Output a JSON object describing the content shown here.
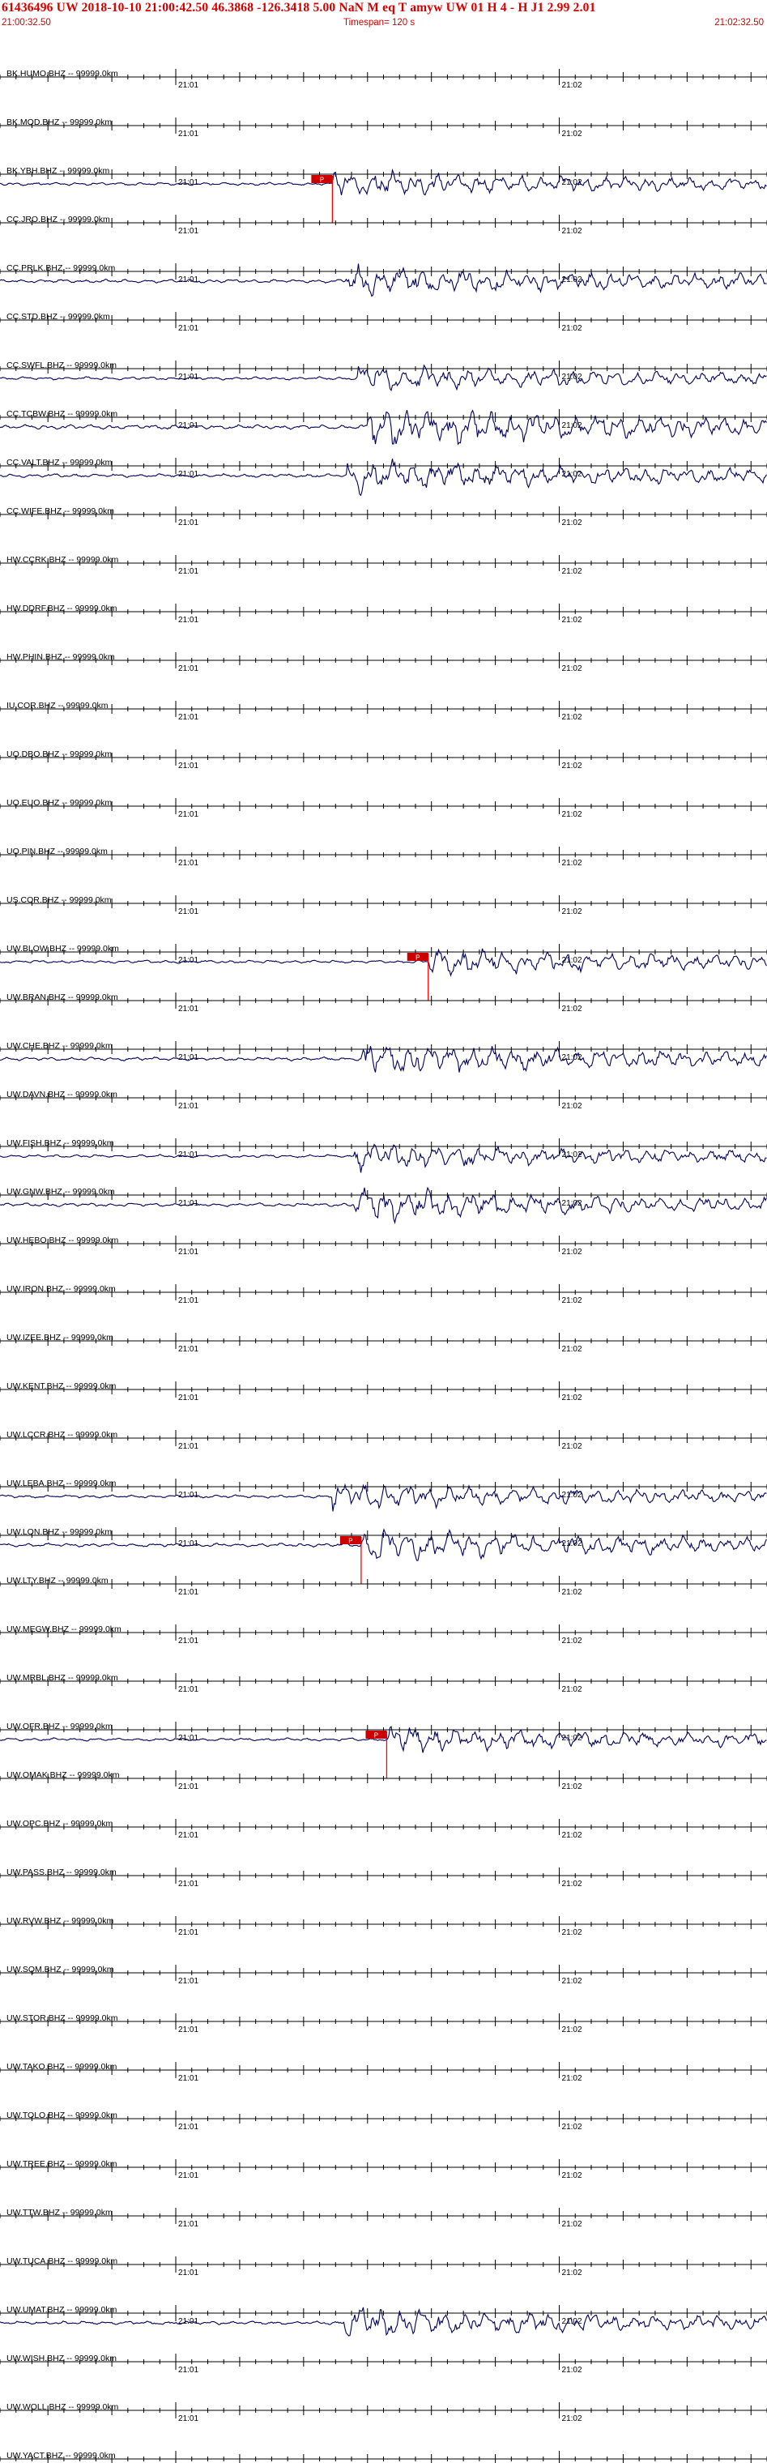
{
  "header": {
    "title": "61436496 UW 2018-10-10 21:00:42.50   46.3868 -126.3418   5.00   NaN M   eq  T amyw     UW 01  H   4  -   H J1    2.99  2.01",
    "start_time": "21:00:32.50",
    "timespan": "Timespan= 120 s",
    "end_time": "21:02:32.50"
  },
  "chart_data": {
    "type": "line",
    "title": "61436496 UW 2018-10-10 21:00:42.50",
    "x_axis": {
      "unit": "s",
      "range": [
        0,
        120
      ],
      "tick_labels": [
        {
          "label": "21:01",
          "t": 27.5
        },
        {
          "label": "21:02",
          "t": 87.5
        }
      ],
      "minor_tick_interval": 2.5
    },
    "colors": {
      "trace": "#00005a",
      "axis": "#000000",
      "pick": "#ff0000",
      "header_text": "#d40000"
    },
    "pick_label": "P",
    "traces": [
      {
        "label": "BK.HUMO.BHZ -- 99999.0km",
        "amp": 0,
        "pick": null
      },
      {
        "label": "BK.MOD.BHZ -- 99999.0km",
        "amp": 0,
        "pick": null
      },
      {
        "label": "BK.YBH.BHZ -- 99999.0km",
        "amp": 12,
        "pick": 52
      },
      {
        "label": "CC.JRO.BHZ -- 99999.0km",
        "amp": 0,
        "pick": null
      },
      {
        "label": "CC.PRLK.BHZ -- 99999.0km",
        "amp": 14,
        "pick": null
      },
      {
        "label": "CC.STD.BHZ -- 99999.0km",
        "amp": 0,
        "pick": null
      },
      {
        "label": "CC.SWFL.BHZ -- 99999.0km",
        "amp": 12,
        "pick": null
      },
      {
        "label": "CC.TCBW.BHZ -- 99999.0km",
        "amp": 18,
        "pick": null
      },
      {
        "label": "CC.VALT.BHZ -- 99999.0km",
        "amp": 14,
        "pick": null
      },
      {
        "label": "CC.WIFE.BHZ -- 99999.0km",
        "amp": 0,
        "pick": null
      },
      {
        "label": "HW.CCRK.BHZ -- 99999.0km",
        "amp": 0,
        "pick": null
      },
      {
        "label": "HW.DDRF.BHZ -- 99999.0km",
        "amp": 0,
        "pick": null
      },
      {
        "label": "HW.PHIN.BHZ -- 99999.0km",
        "amp": 0,
        "pick": null
      },
      {
        "label": "IU.COR.BHZ -- 99999.0km",
        "amp": 0,
        "pick": null
      },
      {
        "label": "UO.DBO.BHZ -- 99999.0km",
        "amp": 0,
        "pick": null
      },
      {
        "label": "UO.EUO.BHZ -- 99999.0km",
        "amp": 0,
        "pick": null
      },
      {
        "label": "UO.PIN.BHZ -- 99999.0km",
        "amp": 0,
        "pick": null
      },
      {
        "label": "US.COR.BHZ -- 99999.0km",
        "amp": 0,
        "pick": null
      },
      {
        "label": "UW.BLOW.BHZ -- 99999.0km",
        "amp": 12,
        "pick": 67
      },
      {
        "label": "UW.BRAN.BHZ -- 99999.0km",
        "amp": 0,
        "pick": null
      },
      {
        "label": "UW.CHE.BHZ -- 99999.0km",
        "amp": 14,
        "pick": null
      },
      {
        "label": "UW.DAVN.BHZ -- 99999.0km",
        "amp": 0,
        "pick": null
      },
      {
        "label": "UW.FISH.BHZ -- 99999.0km",
        "amp": 12,
        "pick": null
      },
      {
        "label": "UW.GNW.BHZ -- 99999.0km",
        "amp": 14,
        "pick": null
      },
      {
        "label": "UW.HEBO.BHZ -- 99999.0km",
        "amp": 0,
        "pick": null
      },
      {
        "label": "UW.IRON.BHZ -- 99999.0km",
        "amp": 0,
        "pick": null
      },
      {
        "label": "UW.IZEE.BHZ -- 99999.0km",
        "amp": 0,
        "pick": null
      },
      {
        "label": "UW.KENT.BHZ -- 99999.0km",
        "amp": 0,
        "pick": null
      },
      {
        "label": "UW.LCCR.BHZ -- 99999.0km",
        "amp": 0,
        "pick": null
      },
      {
        "label": "UW.LEBA.BHZ -- 99999.0km",
        "amp": 12,
        "pick": null
      },
      {
        "label": "UW.LON.BHZ -- 99999.0km",
        "amp": 14,
        "pick": 56.5
      },
      {
        "label": "UW.LTY.BHZ -- 99999.0km",
        "amp": 0,
        "pick": null
      },
      {
        "label": "UW.MEGW.BHZ -- 99999.0km",
        "amp": 0,
        "pick": null
      },
      {
        "label": "UW.MRBL.BHZ -- 99999.0km",
        "amp": 0,
        "pick": null
      },
      {
        "label": "UW.OFR.BHZ -- 99999.0km",
        "amp": 12,
        "pick": 60.5
      },
      {
        "label": "UW.OMAK.BHZ -- 99999.0km",
        "amp": 0,
        "pick": null
      },
      {
        "label": "UW.OPC.BHZ -- 99999.0km",
        "amp": 0,
        "pick": null
      },
      {
        "label": "UW.PASS.BHZ -- 99999.0km",
        "amp": 0,
        "pick": null
      },
      {
        "label": "UW.RVW.BHZ -- 99999.0km",
        "amp": 0,
        "pick": null
      },
      {
        "label": "UW.SQM.BHZ -- 99999.0km",
        "amp": 0,
        "pick": null
      },
      {
        "label": "UW.STOR.BHZ -- 99999.0km",
        "amp": 0,
        "pick": null
      },
      {
        "label": "UW.TAKO.BHZ -- 99999.0km",
        "amp": 0,
        "pick": null
      },
      {
        "label": "UW.TOLO.BHZ -- 99999.0km",
        "amp": 0,
        "pick": null
      },
      {
        "label": "UW.TREE.BHZ -- 99999.0km",
        "amp": 0,
        "pick": null
      },
      {
        "label": "UW.TTW.BHZ -- 99999.0km",
        "amp": 0,
        "pick": null
      },
      {
        "label": "UW.TUCA.BHZ -- 99999.0km",
        "amp": 0,
        "pick": null
      },
      {
        "label": "UW.UMAT.BHZ -- 99999.0km",
        "amp": 14,
        "pick": null
      },
      {
        "label": "UW.WISH.BHZ -- 99999.0km",
        "amp": 0,
        "pick": null
      },
      {
        "label": "UW.WOLL.BHZ -- 99999.0km",
        "amp": 0,
        "pick": null
      },
      {
        "label": "UW.YACT.BHZ -- 99999.0km",
        "amp": 0,
        "pick": null
      }
    ]
  }
}
